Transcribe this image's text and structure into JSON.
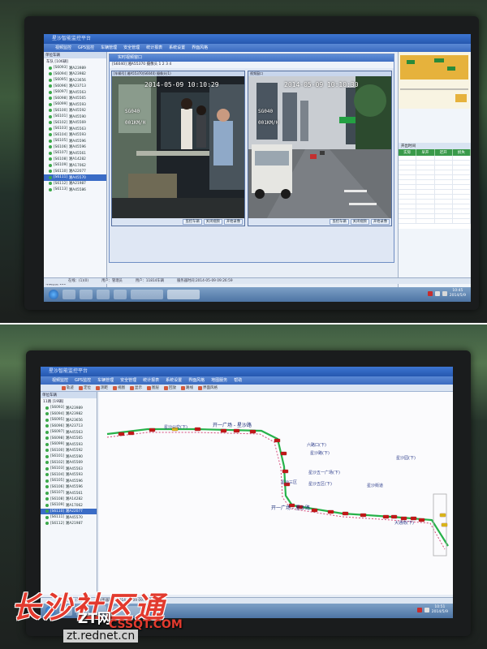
{
  "top": {
    "window_title": "星沙智能监控平台",
    "menus": [
      "视频监控",
      "GPS监控",
      "车辆管理",
      "安全管理",
      "统计报表",
      "系统设置",
      "界面风格"
    ],
    "sidebar": {
      "title": "单位车辆",
      "root": "车队  [106辆]",
      "vehicles": [
        {
          "id": "S6093",
          "plate": "湘A23989"
        },
        {
          "id": "S6094",
          "plate": "湘A23982"
        },
        {
          "id": "S6095",
          "plate": "湘A23656"
        },
        {
          "id": "S6096",
          "plate": "湘A23713"
        },
        {
          "id": "S6097",
          "plate": "湘A45563"
        },
        {
          "id": "S6098",
          "plate": "湘A45565"
        },
        {
          "id": "S6099",
          "plate": "湘A45593"
        },
        {
          "id": "S6100",
          "plate": "湘A45592"
        },
        {
          "id": "S6101",
          "plate": "湘A45590"
        },
        {
          "id": "S6102",
          "plate": "湘A45569"
        },
        {
          "id": "S6103",
          "plate": "湘A45563"
        },
        {
          "id": "S6104",
          "plate": "湘A45593"
        },
        {
          "id": "S6105",
          "plate": "湘A45596"
        },
        {
          "id": "S6106",
          "plate": "湘A45596"
        },
        {
          "id": "S6107",
          "plate": "湘A45561"
        },
        {
          "id": "S6108",
          "plate": "湘A14282"
        },
        {
          "id": "S6109",
          "plate": "湘A17062"
        },
        {
          "id": "S6110",
          "plate": "湘A22077"
        },
        {
          "id": "S6111",
          "plate": "湘A45570"
        },
        {
          "id": "S6112",
          "plate": "湘A21987"
        },
        {
          "id": "S6113",
          "plate": "湘A45586"
        }
      ],
      "selected_index": 18,
      "footer": "车辆总数 106"
    },
    "video_window": {
      "title": "实时视频窗口",
      "info": "[S6040] 湘A55370  摄像头 1  2  3  4",
      "cam_left_header": "[车辆号] 湘A55370(S6040) 摄像头(1)",
      "cam_right_header": "视频窗口",
      "left_osd": {
        "timestamp": "2014-05-09 10:10:29",
        "route": "SG040",
        "speed": "001KM/H"
      },
      "right_osd": {
        "timestamp": "2014-05-09 10:10:30",
        "route": "SG040",
        "speed": "001KM/H"
      },
      "cam_buttons": [
        "监控车辆",
        "关闭视频",
        "开始录像"
      ]
    },
    "right_table": {
      "caption": "开出时间",
      "columns": [
        "实际",
        "早开",
        "迟开",
        "损失"
      ]
    },
    "status": [
      "在线：(1)(0)",
      "用户：管理员",
      "用户：11814车辆",
      "服务器时间:2014-05-09 09:26:59"
    ],
    "clock": {
      "time": "10:45",
      "date": "2014/5/9"
    }
  },
  "bottom": {
    "window_title": "星沙智能监控平台",
    "menus": [
      "视频监控",
      "GPS监控",
      "车辆管理",
      "安全管理",
      "统计报表",
      "系统设置",
      "界面风格",
      "地图服务",
      "帮助"
    ],
    "tools": [
      "轨迹",
      "定位",
      "测距",
      "视图",
      "显示",
      "图层",
      "回放",
      "路线",
      "界面风格"
    ],
    "sidebar_title": "单位车辆",
    "sidebar_root": "11路  [19辆]",
    "route_labels": [
      "星沙公交(下)",
      "开一广场 - 星沙路",
      "星沙五一广场(下)",
      "星沙三区",
      "六路口(下)",
      "星沙路(下)",
      "开一广场 - 星沙路",
      "星沙五区(下)",
      "星沙街道",
      "星沙园(下)",
      "大通南(下)"
    ],
    "status": [
      "在线：(1)(0)",
      "服务器时间:2014-05-09 09:26:59"
    ],
    "clock": {
      "time": "10:51",
      "date": "2014/5/9"
    }
  },
  "watermark": {
    "main": "长沙社区通",
    "sub": "ZT网",
    "url": "zt.rednet.cn",
    "brand_small": "CSSQT.COM"
  }
}
